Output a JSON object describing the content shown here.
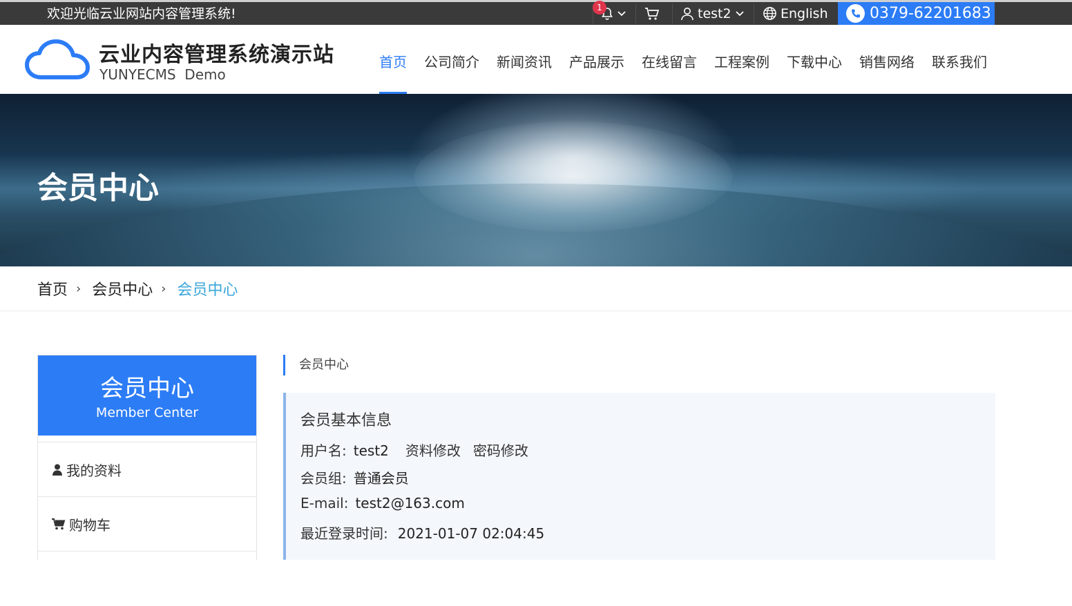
{
  "topbar": {
    "welcome": "欢迎光临云业网站内容管理系统!",
    "notification_count": "1",
    "username": "test2",
    "language": "English",
    "phone": "0379-62201683"
  },
  "header": {
    "site_title": "云业内容管理系统演示站",
    "site_subtitle": "YUNYECMS  Demo",
    "nav": [
      {
        "label": "首页",
        "active": true
      },
      {
        "label": "公司简介"
      },
      {
        "label": "新闻资讯"
      },
      {
        "label": "产品展示"
      },
      {
        "label": "在线留言"
      },
      {
        "label": "工程案例"
      },
      {
        "label": "下载中心"
      },
      {
        "label": "销售网络"
      },
      {
        "label": "联系我们"
      }
    ]
  },
  "banner": {
    "title": "会员中心"
  },
  "breadcrumb": [
    "首页",
    "会员中心",
    "会员中心"
  ],
  "sidebar": {
    "title": "会员中心",
    "subtitle": "Member Center",
    "items": [
      {
        "label": "我的资料",
        "icon": "user-icon"
      },
      {
        "label": "购物车",
        "icon": "cart-icon"
      }
    ]
  },
  "main": {
    "section_title": "会员中心",
    "info_title": "会员基本信息",
    "username_label": "用户名:",
    "username_value": "test2",
    "edit_profile": "资料修改",
    "change_password": "密码修改",
    "group_label": "会员组:",
    "group_value": "普通会员",
    "email_label": "E-mail:",
    "email_value": "test2@163.com",
    "last_login_label": "最近登录时间:",
    "last_login_value": "2021-01-07 02:04:45"
  },
  "colors": {
    "accent": "#2c7cf6",
    "topbar": "#3a3a3a",
    "breadcrumb_current": "#39a5d9",
    "badge": "#e0344b"
  }
}
